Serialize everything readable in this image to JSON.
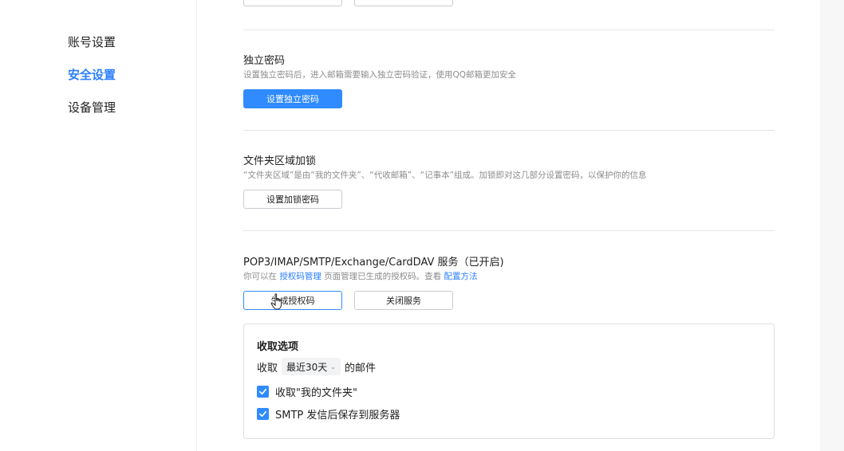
{
  "sidebar": {
    "items": [
      {
        "label": "账号设置",
        "active": false
      },
      {
        "label": "安全设置",
        "active": true
      },
      {
        "label": "设备管理",
        "active": false
      }
    ]
  },
  "sections": {
    "independent_password": {
      "title": "独立密码",
      "desc": "设置独立密码后，进入邮箱需要输入独立密码验证，使用QQ邮箱更加安全",
      "button": "设置独立密码"
    },
    "folder_lock": {
      "title": "文件夹区域加锁",
      "desc": "“文件夹区域”是由“我的文件夹”、“代收邮箱”、“记事本”组成。加锁即对这几部分设置密码，以保护你的信息",
      "button": "设置加锁密码"
    },
    "pop3": {
      "title": "POP3/IMAP/SMTP/Exchange/CardDAV 服务（已开启)",
      "desc_prefix": "你可以在",
      "desc_link1": "授权码管理",
      "desc_middle": "页面管理已生成的授权码。查看",
      "desc_link2": "配置方法",
      "button_generate": "生成授权码",
      "button_close": "关闭服务"
    }
  },
  "receive_options": {
    "title": "收取选项",
    "receive_label": "收取",
    "range_value": "最近30天",
    "mail_suffix": "的邮件",
    "checkbox1_label": "收取\"我的文件夹\"",
    "checkbox1_checked": true,
    "checkbox2_label": "SMTP 发信后保存到服务器",
    "checkbox2_checked": true
  },
  "colors": {
    "accent": "#2f8bff",
    "active_nav": "#2b7fff",
    "muted_text": "#8c8c8c"
  }
}
